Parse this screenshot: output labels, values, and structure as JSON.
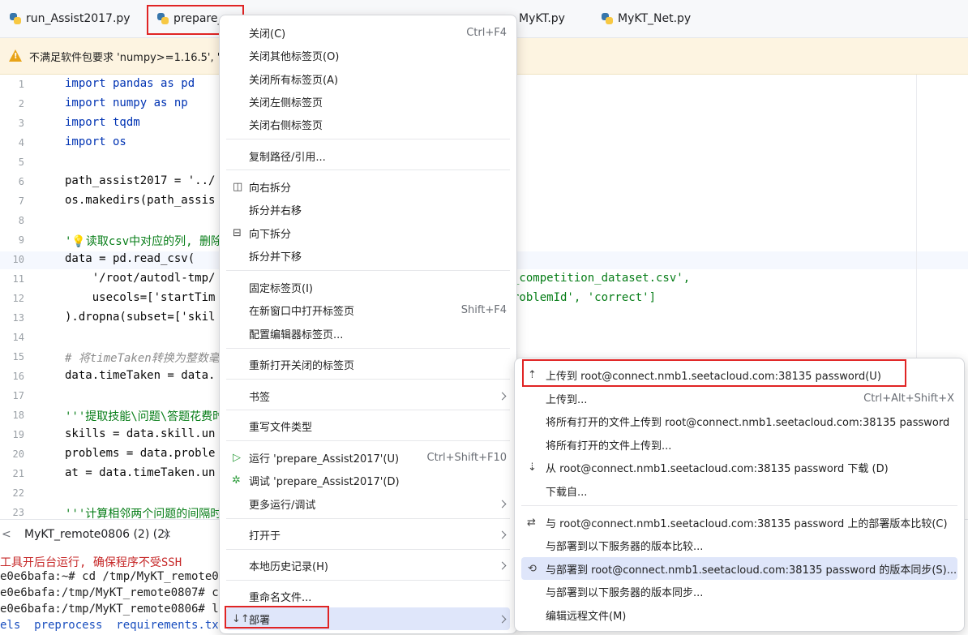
{
  "tabs": [
    {
      "label": "run_Assist2017.py",
      "icon": "python-file-icon"
    },
    {
      "label": "prepare_",
      "icon": "python-file-icon"
    },
    {
      "label": "MyKT.py",
      "icon": "python-file-icon"
    },
    {
      "label": "MyKT_Net.py",
      "icon": "python-file-icon"
    }
  ],
  "warning": {
    "icon": "warning-icon",
    "text": "不满足软件包要求 'numpy>=1.16.5', 'p"
  },
  "editor": {
    "lines": [
      {
        "n": "1",
        "t": "import pandas as pd"
      },
      {
        "n": "2",
        "t": "import numpy as np"
      },
      {
        "n": "3",
        "t": "import tqdm"
      },
      {
        "n": "4",
        "t": "import os"
      },
      {
        "n": "5",
        "t": ""
      },
      {
        "n": "6",
        "t": "path_assist2017 = '../"
      },
      {
        "n": "7",
        "t": "os.makedirs(path_assis"
      },
      {
        "n": "8",
        "t": ""
      },
      {
        "n": "9",
        "t": "'💡读取csv中对应的列, 删除"
      },
      {
        "n": "10",
        "t": "data = pd.read_csv("
      },
      {
        "n": "11",
        "t": "    '/root/autodl-tmp/"
      },
      {
        "n": "12",
        "t": "    usecols=['startTim"
      },
      {
        "n": "13",
        "t": ").dropna(subset=['skil"
      },
      {
        "n": "14",
        "t": ""
      },
      {
        "n": "15",
        "t": "# 将timeTaken转换为整数毫"
      },
      {
        "n": "16",
        "t": "data.timeTaken = data."
      },
      {
        "n": "17",
        "t": ""
      },
      {
        "n": "18",
        "t": "'''提取技能\\问题\\答题花费时"
      },
      {
        "n": "19",
        "t": "skills = data.skill.un"
      },
      {
        "n": "20",
        "t": "problems = data.proble"
      },
      {
        "n": "21",
        "t": "at = data.timeTaken.un"
      },
      {
        "n": "22",
        "t": ""
      },
      {
        "n": "23",
        "t": "'''计算相邻两个问题的间隔时"
      }
    ],
    "right_fragments": [
      {
        "line": "11",
        "t": "_competition_dataset.csv',"
      },
      {
        "line": "12",
        "t": "roblemId', 'correct']"
      }
    ]
  },
  "terminal": {
    "tab_label": "MyKT_remote0806 (2) (2)",
    "close": "×",
    "lines": [
      "工具开后台运行, 确保程序不受SSH",
      "e0e6bafa:~# cd /tmp/MyKT_remote0",
      "e0e6bafa:/tmp/MyKT_remote0807# c",
      "e0e6bafa:/tmp/MyKT_remote0806# l",
      "els  preprocess  requirements.tx"
    ]
  },
  "context_menu": {
    "items": [
      {
        "label": "关闭(C)",
        "shortcut": "Ctrl+F4"
      },
      {
        "label": "关闭其他标签页(O)"
      },
      {
        "label": "关闭所有标签页(A)"
      },
      {
        "label": "关闭左侧标签页"
      },
      {
        "label": "关闭右侧标签页"
      },
      {
        "label": "复制路径/引用..."
      },
      {
        "label": "向右拆分",
        "icon": "split-right-icon"
      },
      {
        "label": "拆分并右移"
      },
      {
        "label": "向下拆分",
        "icon": "split-down-icon"
      },
      {
        "label": "拆分并下移"
      },
      {
        "label": "固定标签页(I)"
      },
      {
        "label": "在新窗口中打开标签页",
        "shortcut": "Shift+F4"
      },
      {
        "label": "配置编辑器标签页..."
      },
      {
        "label": "重新打开关闭的标签页"
      },
      {
        "label": "书签",
        "submenu": true
      },
      {
        "label": "重写文件类型"
      },
      {
        "label": "运行 'prepare_Assist2017'(U)",
        "shortcut": "Ctrl+Shift+F10",
        "icon": "run-icon"
      },
      {
        "label": "调试 'prepare_Assist2017'(D)",
        "icon": "debug-icon"
      },
      {
        "label": "更多运行/调试",
        "submenu": true
      },
      {
        "label": "打开于",
        "submenu": true
      },
      {
        "label": "本地历史记录(H)",
        "submenu": true
      },
      {
        "label": "重命名文件..."
      },
      {
        "label": "部署",
        "submenu": true,
        "icon": "deploy-icon"
      }
    ]
  },
  "deploy_submenu": {
    "items": [
      {
        "label": "上传到 root@connect.nmb1.seetacloud.com:38135 password(U)",
        "icon": "upload-icon"
      },
      {
        "label": "上传到...",
        "shortcut": "Ctrl+Alt+Shift+X"
      },
      {
        "label": "将所有打开的文件上传到 root@connect.nmb1.seetacloud.com:38135 password"
      },
      {
        "label": "将所有打开的文件上传到..."
      },
      {
        "label": "从 root@connect.nmb1.seetacloud.com:38135 password 下载 (D)",
        "icon": "download-icon"
      },
      {
        "label": "下载自..."
      },
      {
        "label": "与 root@connect.nmb1.seetacloud.com:38135 password 上的部署版本比较(C)",
        "icon": "compare-icon"
      },
      {
        "label": "与部署到以下服务器的版本比较..."
      },
      {
        "label": "与部署到 root@connect.nmb1.seetacloud.com:38135 password 的版本同步(S)...",
        "icon": "sync-icon"
      },
      {
        "label": "与部署到以下服务器的版本同步..."
      },
      {
        "label": "编辑远程文件(M)"
      }
    ]
  }
}
